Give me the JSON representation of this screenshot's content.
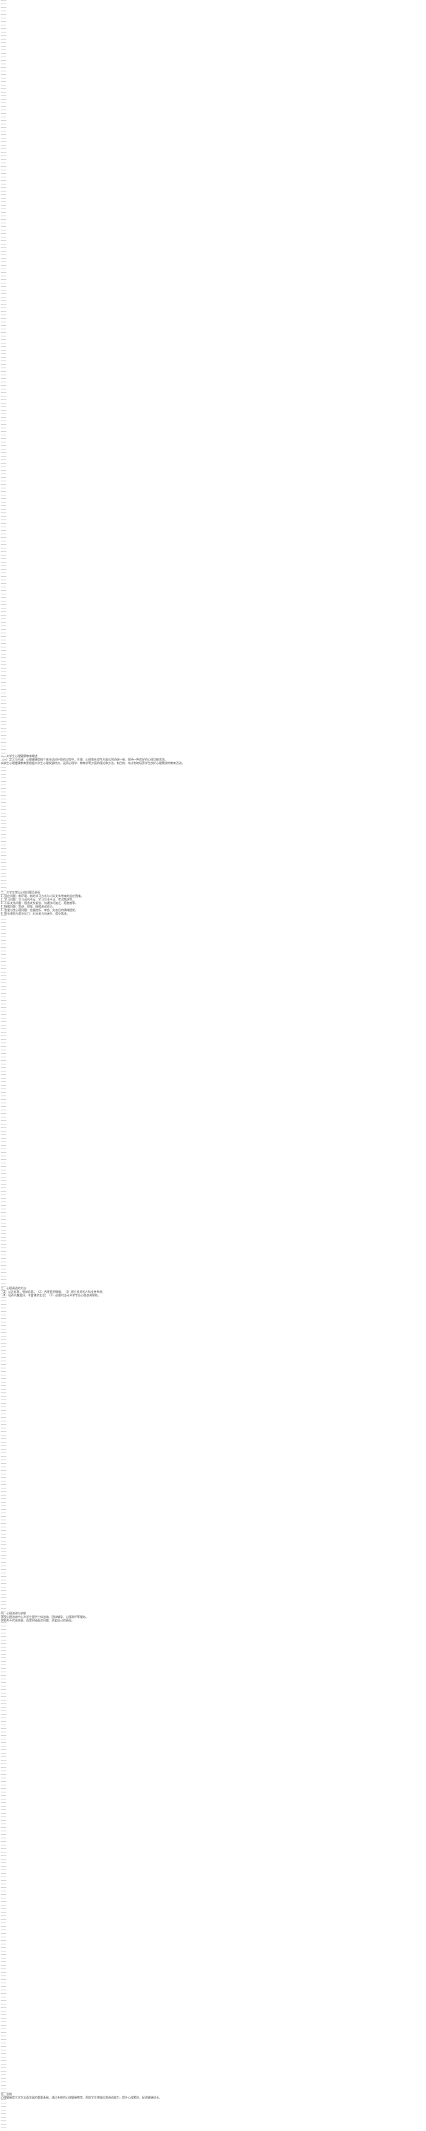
{
  "document": {
    "sections": [
      {
        "id": "s1",
        "lines": [
          "一、大学生心理健康教育概述",
          "（一）定义与内涵：心理健康是指个体在适应环境的过程中，生理、心理和社会性方面达到协调一致，保持一种良好的心理功能状态。",
          "大学生心理健康教育是根据大学生心理发展特点，运用心理学、教育学等方面的理论和方法，有目的、有计划地培养学生良好心理素质的教育活动。"
        ]
      },
      {
        "id": "s2",
        "lines": [
          "二、大学生常见心理问题及表现",
          "1. 适应问题：新环境、新的学习方式与人际关系带来的适应困难。",
          "2. 学习问题：学习动机不足、学习方法不当、考试焦虑等。",
          "3. 人际关系问题：宿舍关系紧张、沟通技巧缺乏、孤独感等。",
          "4. 情绪问题：焦虑、抑郁、情绪波动较大。",
          "5. 恋爱与性心理问题：恋爱挫折、单恋、失恋后的情绪困扰。",
          "6. 职业规划与就业压力：对未来方向迷茫、就业焦虑。"
        ]
      },
      {
        "id": "s3",
        "lines": [
          "三、心理调适的方法",
          "（1）认识自我，悦纳自我；（2）合理宣泄情绪；（3）建立良好的人际支持系统；",
          "（4）培养兴趣爱好，丰富课余生活；（5）必要时主动寻求专业心理咨询帮助。"
        ]
      },
      {
        "id": "s4",
        "lines": [
          "四、心理咨询与求助",
          "学校心理咨询中心为学生提供个体咨询、团体辅导、心理测评等服务。",
          "求助并不代表软弱，而是积极面对问题、关爱自己的表现。"
        ]
      },
      {
        "id": "s5",
        "lines": [
          "五、总结",
          "心理健康是大学生全面发展的重要基础。通过系统的心理健康教育，帮助学生增强自我调适能力，提升心理素质，促进健康成长。"
        ]
      }
    ]
  }
}
